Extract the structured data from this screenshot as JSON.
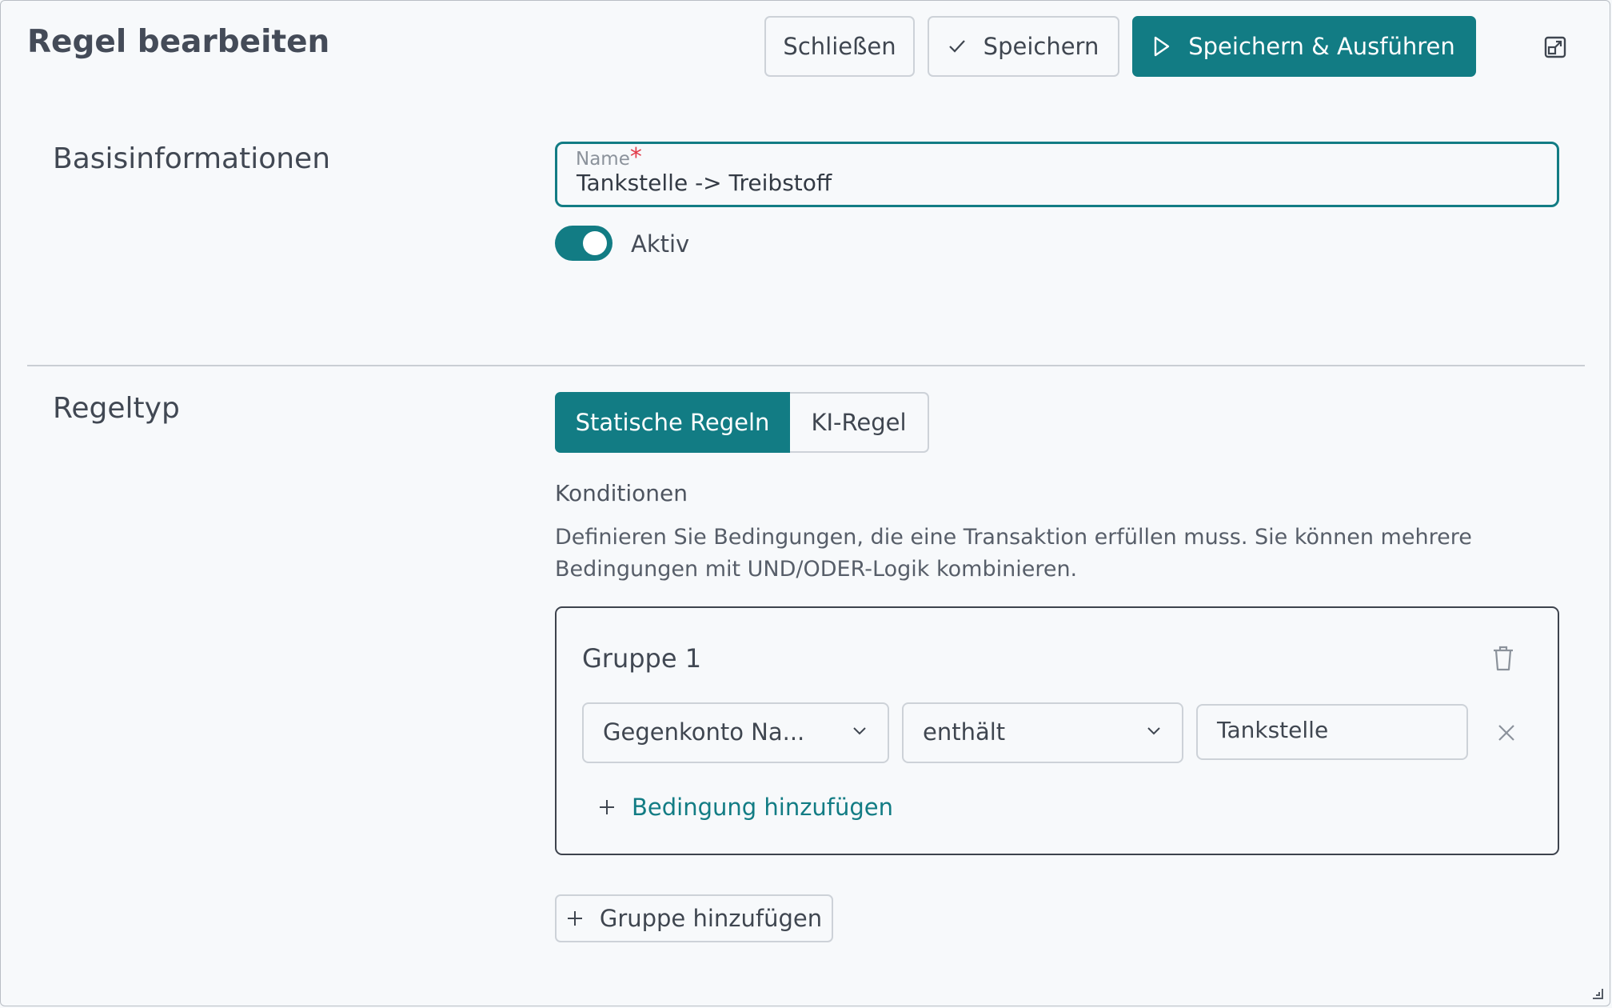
{
  "dialog": {
    "title": "Regel bearbeiten",
    "close_label": "Schließen",
    "save_label": "Speichern",
    "save_run_label": "Speichern & Ausführen"
  },
  "basis": {
    "section_label": "Basisinformationen",
    "name_label": "Name",
    "required_marker": "*",
    "name_value": "Tankstelle -> Treibstoff",
    "active_label": "Aktiv",
    "active": true
  },
  "rule_type": {
    "section_label": "Regeltyp",
    "options": [
      "Statische Regeln",
      "KI-Regel"
    ],
    "selected": "Statische Regeln"
  },
  "conditions": {
    "heading": "Konditionen",
    "description": "Definieren Sie Bedingungen, die eine Transaktion erfüllen muss. Sie können mehrere Bedingungen mit UND/ODER-Logik kombinieren.",
    "groups": [
      {
        "title": "Gruppe 1",
        "rows": [
          {
            "field": "Gegenkonto Na...",
            "operator": "enthält",
            "value": "Tankstelle"
          }
        ],
        "add_condition_label": "Bedingung hinzufügen"
      }
    ],
    "add_group_label": "Gruppe hinzufügen"
  },
  "colors": {
    "accent": "#127c84",
    "required": "#e23b4a",
    "background": "#f7f9fb"
  },
  "icons": [
    "check-icon",
    "play-icon",
    "maximize-icon",
    "trash-icon",
    "chevron-down-icon",
    "close-icon",
    "plus-icon",
    "resize-grip-icon"
  ]
}
